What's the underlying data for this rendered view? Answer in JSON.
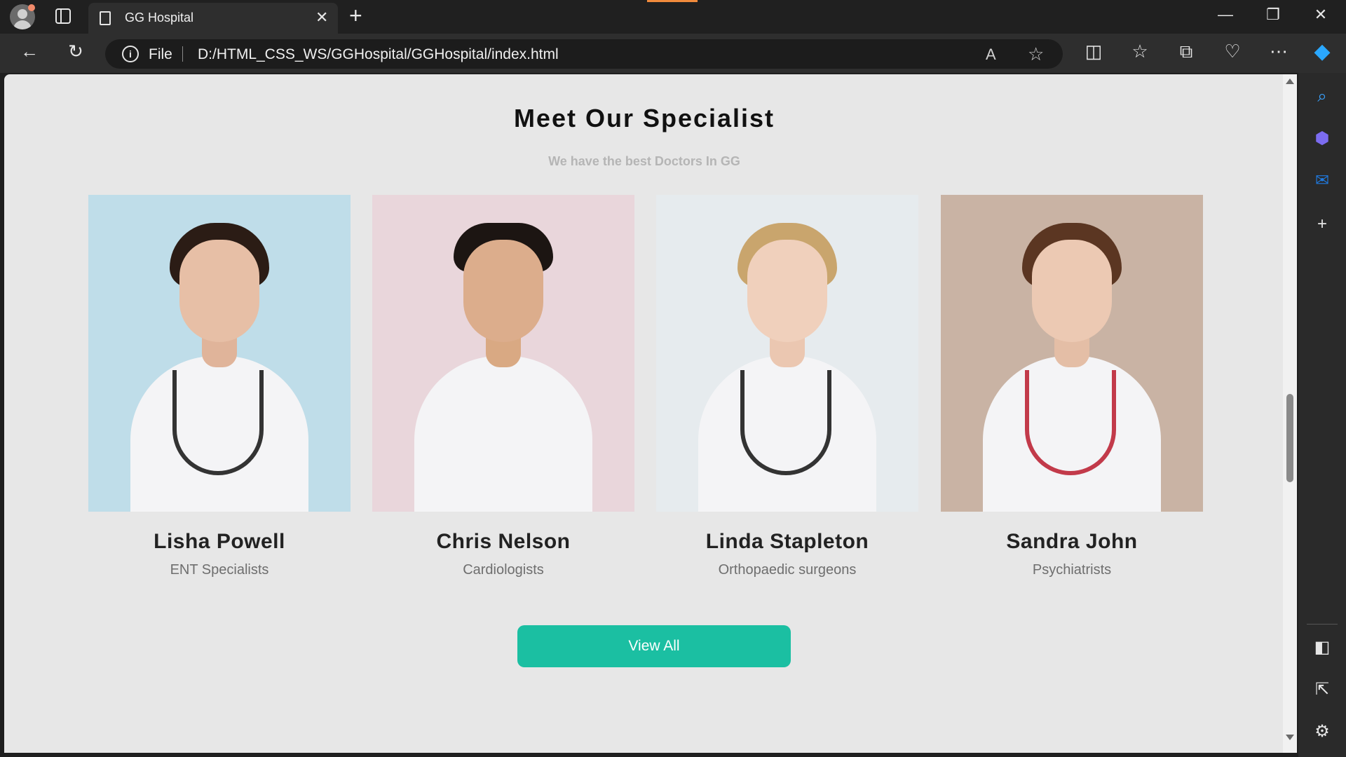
{
  "browser": {
    "tab_title": "GG Hospital",
    "address_scheme": "File",
    "url": "D:/HTML_CSS_WS/GGHospital/GGHospital/index.html",
    "read_aloud_label": "A"
  },
  "page": {
    "title": "Meet Our Specialist",
    "subtitle": "We have the best Doctors In GG",
    "doctors": [
      {
        "name": "Lisha Powell",
        "role": "ENT Specialists"
      },
      {
        "name": "Chris Nelson",
        "role": "Cardiologists"
      },
      {
        "name": "Linda Stapleton",
        "role": "Orthopaedic surgeons"
      },
      {
        "name": "Sandra John",
        "role": "Psychiatrists"
      }
    ],
    "view_all_label": "View All"
  },
  "colors": {
    "accent_button": "#1bbfa2",
    "page_background": "#e7e7e7"
  },
  "icons": {
    "back": "back-arrow-icon",
    "refresh": "refresh-icon",
    "favorite": "star-icon",
    "more": "more-icon"
  }
}
